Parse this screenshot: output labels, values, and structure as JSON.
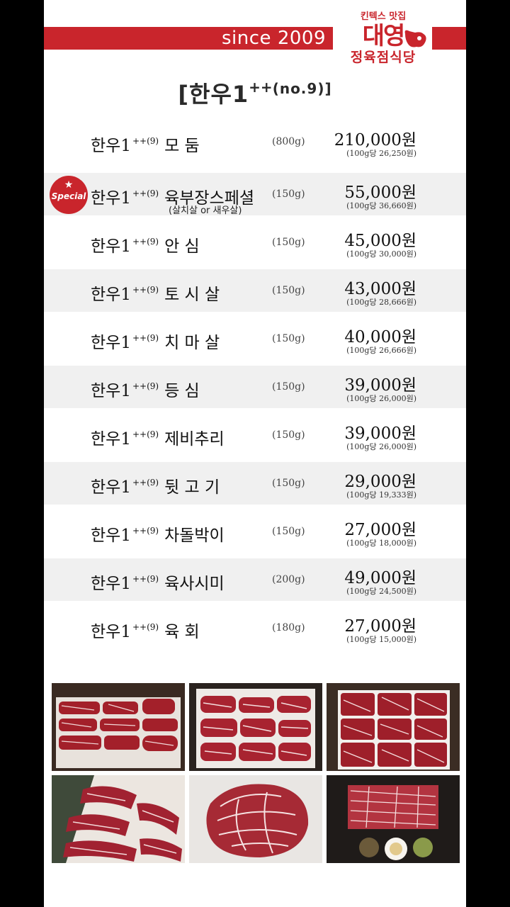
{
  "header": {
    "since": "since 2009",
    "logo_top": "킨텍스 맛집",
    "logo_mid": "대영",
    "logo_bot": "정육점식당"
  },
  "title": {
    "main": "[한우1",
    "grade": "++",
    "suffix": "(no.9)]"
  },
  "menu": [
    {
      "name": "한우1",
      "grade": "++(9)",
      "cut": "모    둠",
      "weight": "(800g)",
      "price": "210,000원",
      "per": "(100g당 26,250원)"
    },
    {
      "name": "한우1",
      "grade": "++(9)",
      "cut": "육부장스페셜",
      "weight": "(150g)",
      "price": "55,000원",
      "per": "(100g당 36,660원)",
      "sub": "(살치살 or 새우살)",
      "badge": "Special"
    },
    {
      "name": "한우1",
      "grade": "++(9)",
      "cut": "안    심",
      "weight": "(150g)",
      "price": "45,000원",
      "per": "(100g당 30,000원)"
    },
    {
      "name": "한우1",
      "grade": "++(9)",
      "cut": "토 시 살",
      "weight": "(150g)",
      "price": "43,000원",
      "per": "(100g당 28,666원)"
    },
    {
      "name": "한우1",
      "grade": "++(9)",
      "cut": "치 마 살",
      "weight": "(150g)",
      "price": "40,000원",
      "per": "(100g당 26,666원)"
    },
    {
      "name": "한우1",
      "grade": "++(9)",
      "cut": "등    심",
      "weight": "(150g)",
      "price": "39,000원",
      "per": "(100g당 26,000원)"
    },
    {
      "name": "한우1",
      "grade": "++(9)",
      "cut": "제비추리",
      "weight": "(150g)",
      "price": "39,000원",
      "per": "(100g당 26,000원)"
    },
    {
      "name": "한우1",
      "grade": "++(9)",
      "cut": "뒷 고 기",
      "weight": "(150g)",
      "price": "29,000원",
      "per": "(100g당 19,333원)"
    },
    {
      "name": "한우1",
      "grade": "++(9)",
      "cut": "차돌박이",
      "weight": "(150g)",
      "price": "27,000원",
      "per": "(100g당 18,000원)"
    },
    {
      "name": "한우1",
      "grade": "++(9)",
      "cut": "육사시미",
      "weight": "(200g)",
      "price": "49,000원",
      "per": "(100g당 24,500원)"
    },
    {
      "name": "한우1",
      "grade": "++(9)",
      "cut": "육    회",
      "weight": "(180g)",
      "price": "27,000원",
      "per": "(100g당 15,000원)"
    }
  ],
  "colors": {
    "brand_red": "#c9252c",
    "row_shade": "#f0f0f0",
    "meat_red": "#a3202a",
    "marbling": "#f2d8d8"
  }
}
